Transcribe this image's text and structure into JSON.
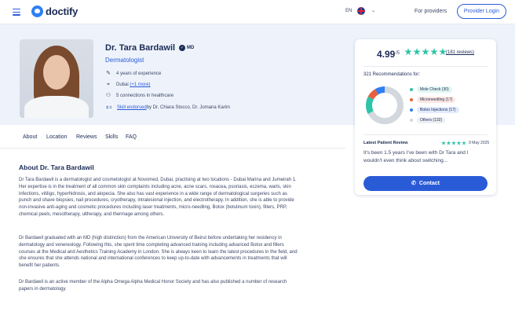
{
  "header": {
    "logo": "doctify",
    "lang": "EN",
    "providers_link": "For providers",
    "login_button": "Provider Login"
  },
  "profile": {
    "name": "Dr. Tara Bardawil",
    "credential": "MD",
    "specialty": "Dermatologist",
    "experience": "4 years of experience",
    "location": "Dubai",
    "location_more": "(+1 more)",
    "connections": "5 connections in healthcare",
    "endorsed_link": "Skill endorsed",
    "endorsed_by": " by Dr. Chiara Stocco, Dr. Jomana Karim"
  },
  "card": {
    "rating": "4.99",
    "rating_of": "/5",
    "stars": 5,
    "reviews_link": "(181 reviews)",
    "recommendations_title": "321 Recommendations for:",
    "recommendations": [
      {
        "label": "Mole Check (30)",
        "value": 30,
        "color": "#2ec4a6",
        "bg": "#e2f6f2"
      },
      {
        "label": "Microneedling (17)",
        "value": 17,
        "color": "#e8603c",
        "bg": "#fde8e1"
      },
      {
        "label": "Botox Injections (17)",
        "value": 17,
        "color": "#2f7ff5",
        "bg": "#e2ecfd"
      },
      {
        "label": "Others (132)",
        "value": 132,
        "color": "#d3d7de",
        "bg": "#eef0f4"
      }
    ],
    "latest_review_title": "Latest Patient Review",
    "latest_review_date": "9 May 2025",
    "latest_review_text": "It's been 1.5 years I've been with Dr Tara and I wouldn't even think about switching...",
    "contact_button": "Contact"
  },
  "subnav": [
    "About",
    "Location",
    "Reviews",
    "Skills",
    "FAQ"
  ],
  "about": {
    "title": "About Dr. Tara Bardawil",
    "paragraphs": [
      "Dr Tara Bardawil is a dermatologist and cosmetologist at Novomed, Dubai, practising at two locations - Dubai Marina and Jumeirah 1. Her expertise is in the treatment of all common skin complaints including acne, acne scars, rosacea, psoriasis, eczema, warts, skin infections, vitiligo, hyperhidrosis, and alopecia. She also has vast experience in a wide range of dermatological surgeries such as punch and shave biopsies, nail procedures, cryotherapy, intralesional injection, and electrotherapy. In addition, she is able to provide non-invasive anti-aging and cosmetic procedures including laser treatments, micro-needling, Botox (botulinum toxin), fillers, PRP, chemical peels, mesotherapy, ultherapy, and thermage among others.",
      "Dr Bardawil graduated with an MD (high distinction) from the American University of Beirut before undertaking her residency in dermatology and venereology. Following this, she spent time completing advanced training including advanced Botox and fillers courses at the Medical and Aesthetics Training Academy in London. She is always keen to learn the latest procedures in the field, and she ensures that she attends national and international conferences to keep up-to-date with advancements in treatments that will benefit her patients.",
      "Dr Bardawil is an active member of the Alpha Omega Alpha Medical Honor Society and has also published a number of research papers in dermatology."
    ]
  }
}
